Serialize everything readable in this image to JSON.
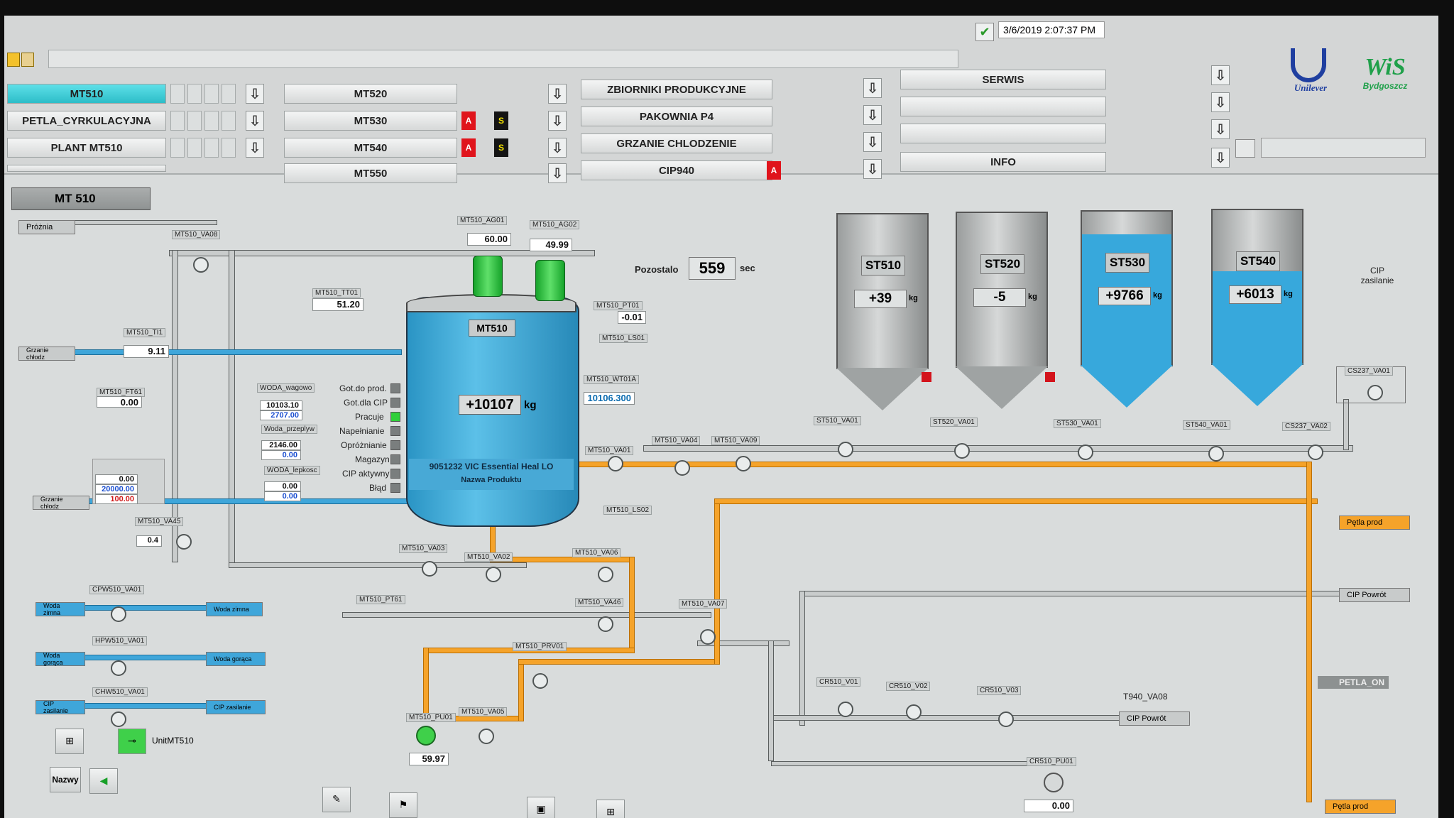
{
  "header": {
    "datetime": "3/6/2019 2:07:37 PM",
    "logo_unilever": "Unilever",
    "logo_wis": "WiS",
    "logo_wis_sub": "Bydgoszcz"
  },
  "nav": {
    "col1": [
      "MT510",
      "PETLA_CYRKULACYJNA",
      "PLANT MT510",
      ""
    ],
    "col2": [
      "MT520",
      "MT530",
      "MT540",
      "MT550"
    ],
    "col3": [
      "ZBIORNIKI PRODUKCYJNE",
      "PAKOWNIA P4",
      "GRZANIE CHLODZENIE",
      "CIP940"
    ],
    "col4": [
      "SERWIS",
      "",
      "",
      "INFO"
    ],
    "badge_a": "A",
    "badge_s": "S",
    "arrow_glyph": "⇩"
  },
  "process": {
    "section_title": "MT 510",
    "tank": {
      "name": "MT510",
      "weight": "+10107",
      "unit": "kg",
      "product": "9051232 VIC Essential Heal LO",
      "product_label": "Nazwa Produktu"
    },
    "remaining": {
      "label": "Pozostalo",
      "value": "559",
      "unit": "sec"
    },
    "instruments": {
      "ag01_tag": "MT510_AG01",
      "ag01_val": "60.00",
      "ag02_tag": "MT510_AG02",
      "ag02_val": "49.99",
      "tt01_tag": "MT510_TT01",
      "tt01_val": "51.20",
      "pt01_tag": "MT510_PT01",
      "pt01_val": "-0.01",
      "wt01_tag": "MT510_WT01A",
      "wt01_val": "10106.300",
      "ti_tag": "MT510_TI1",
      "ti_val": "9.11",
      "ft_tag": "MT510_FT61",
      "ft_val": "0.00",
      "pid_val1": "0.00",
      "pid_val2": "20000.00",
      "pid_val3": "100.00",
      "va45_val": "0.4",
      "pu01_val": "59.97",
      "cr_pu_val": "0.00",
      "woda_wagowo": "WODA_wagowo",
      "woda_wagowo_v1": "10103.10",
      "woda_wagowo_v2": "2707.00",
      "woda_przeplyw": "Woda_przeplyw",
      "woda_przeplyw_v1": "2146.00",
      "woda_przeplyw_v2": "0.00",
      "woda_lepkosc": "WODA_lepkosc",
      "woda_lepkosc_v1": "0.00",
      "woda_lepkosc_v2": "0.00"
    },
    "status_list": [
      "Got.do prod.",
      "Got.dla CIP",
      "Pracuje",
      "Napełnianie",
      "Opróżnianie",
      "Magazyn",
      "CIP aktywny",
      "Błąd"
    ],
    "silos": [
      {
        "name": "ST510",
        "qty": "+39",
        "fill": 0
      },
      {
        "name": "ST520",
        "qty": "-5",
        "fill": 0
      },
      {
        "name": "ST530",
        "qty": "+9766",
        "fill": 0.85
      },
      {
        "name": "ST540",
        "qty": "+6013",
        "fill": 0.6
      }
    ],
    "kg": "kg",
    "cip_zasilanie": "CIP zasilanie",
    "line_labels": {
      "prozna": "Próżnia",
      "grzanie1": "Grzanie chłodz",
      "grzanie2": "Grzanie chłodz",
      "woda_zimna_in": "Woda zimna",
      "woda_zimna_out": "Woda zimna",
      "woda_goraca_in": "Woda gorąca",
      "woda_goraca_out": "Woda gorąca",
      "cip_zas_in": "CIP zasilanie",
      "cip_zas_out": "CIP zasilanie",
      "petla_prod": "Pętla prod",
      "petla_prod2": "Pętla prod",
      "cip_powrot": "CIP Powrót",
      "cip_powrot2": "CIP Powrót",
      "t940": "T940_VA08",
      "petla_on": "PETLA_ON",
      "unit_mt510": "UnitMT510"
    },
    "valve_tags": [
      "MT510_VA08",
      "MT510_VA01",
      "MT510_VA04",
      "MT510_VA09",
      "MT510_VA03",
      "MT510_VA02",
      "MT510_VA06",
      "MT510_VA46",
      "MT510_VA07",
      "MT510_PRV01",
      "MT510_VA05",
      "MT510_PU01",
      "MT510_VA45",
      "CPW510_VA01",
      "HPW510_VA01",
      "CHW510_VA01",
      "ST510_VA01",
      "ST520_VA01",
      "ST530_VA01",
      "ST540_VA01",
      "CS237_VA01",
      "CS237_VA02",
      "CR510_V01",
      "CR510_V02",
      "CR510_V03",
      "CR510_PU01",
      "MT510_PT61",
      "MT510_LS01",
      "MT510_LS02"
    ],
    "nazwy": "Nazwy"
  }
}
